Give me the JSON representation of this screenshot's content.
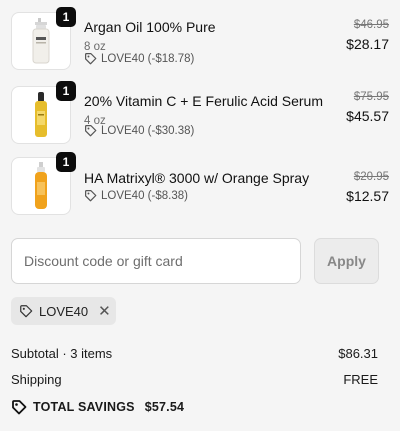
{
  "items": [
    {
      "quantity": "1",
      "name": "Argan Oil 100% Pure",
      "variant": "8 oz",
      "discount": "LOVE40 (-$18.78)",
      "original_price": "$46.95",
      "final_price": "$28.17",
      "image_icon": "white-pump-bottle-icon"
    },
    {
      "quantity": "1",
      "name": "20% Vitamin C + E Ferulic Acid Serum",
      "variant": "4 oz",
      "discount": "LOVE40 (-$30.38)",
      "original_price": "$75.95",
      "final_price": "$45.57",
      "image_icon": "yellow-serum-bottle-icon"
    },
    {
      "quantity": "1",
      "name": "HA Matrixyl® 3000 w/ Orange Spray",
      "variant": "",
      "discount": "LOVE40 (-$8.38)",
      "original_price": "$20.95",
      "final_price": "$12.57",
      "image_icon": "orange-spray-bottle-icon"
    }
  ],
  "discount_form": {
    "placeholder": "Discount code or gift card",
    "apply_label": "Apply"
  },
  "applied_code": {
    "code": "LOVE40"
  },
  "summary": {
    "subtotal_label": "Subtotal · 3 items",
    "subtotal_value": "$86.31",
    "shipping_label": "Shipping",
    "shipping_value": "FREE",
    "total_savings_label": "TOTAL SAVINGS",
    "total_savings_value": "$57.54"
  }
}
